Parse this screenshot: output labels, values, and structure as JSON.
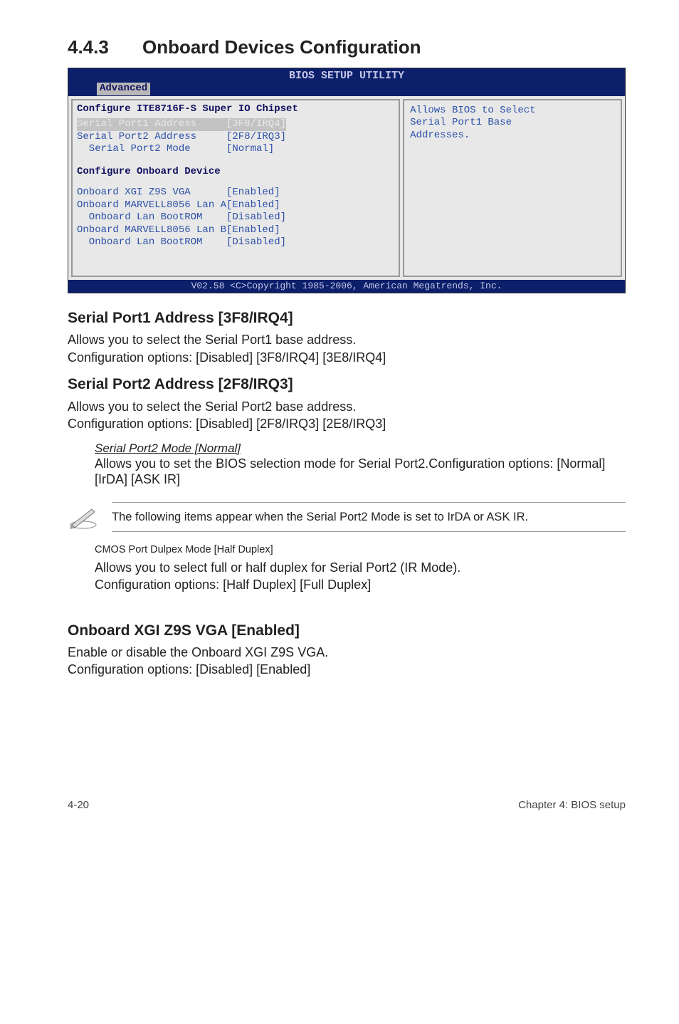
{
  "section": {
    "number": "4.4.3",
    "title": "Onboard Devices Configuration"
  },
  "bios": {
    "window_title": "BIOS SETUP UTILITY",
    "tab": "Advanced",
    "left": {
      "hdr1": "Configure ITE8716F-S Super IO Chipset",
      "rows1": [
        {
          "label": "Serial Port1 Address",
          "val": "[3F8/IRQ4]",
          "sel": true
        },
        {
          "label": "Serial Port2 Address",
          "val": "[2F8/IRQ3]"
        },
        {
          "label": "  Serial Port2 Mode",
          "val": "[Normal]"
        }
      ],
      "hdr2": "Configure Onboard Device",
      "rows2": [
        {
          "label": "Onboard XGI Z9S VGA",
          "val": "[Enabled]"
        },
        {
          "label": "Onboard MARVELL8056 Lan A",
          "val": "[Enabled]"
        },
        {
          "label": "  Onboard Lan BootROM",
          "val": "[Disabled]",
          "indent": true
        },
        {
          "label": "Onboard MARVELL8056 Lan B",
          "val": "[Enabled]"
        },
        {
          "label": "  Onboard Lan BootROM",
          "val": "[Disabled]",
          "indent": true
        }
      ]
    },
    "right_text": "Allows BIOS to Select\nSerial Port1 Base\nAddresses.",
    "footer": "V02.58 <C>Copyright 1985-2006, American Megatrends, Inc."
  },
  "sp1": {
    "head": "Serial Port1 Address [3F8/IRQ4]",
    "p1": "Allows you to select the Serial Port1 base address.",
    "p2": "Configuration options: [Disabled] [3F8/IRQ4] [3E8/IRQ4]"
  },
  "sp2": {
    "head": "Serial Port2 Address [2F8/IRQ3]",
    "p1": "Allows you to select the Serial Port2 base address.",
    "p2": "Configuration options: [Disabled] [2F8/IRQ3] [2E8/IRQ3]"
  },
  "sp2mode": {
    "it": "Serial Port2 Mode [Normal]",
    "p1": "Allows you to set the BIOS selection mode for Serial Port2.Configuration options: [Normal] [IrDA] [ASK IR]"
  },
  "note": "The following items appear when the Serial Port2 Mode is set to IrDA or ASK IR.",
  "cmos": {
    "head": "CMOS Port Dulpex Mode [Half Duplex]",
    "p1": "Allows you to select full or half duplex for Serial Port2 (IR Mode).",
    "p2": "Configuration options: [Half Duplex] [Full Duplex]"
  },
  "xgi": {
    "head": "Onboard XGI Z9S VGA [Enabled]",
    "p1": "Enable or disable the Onboard XGI Z9S VGA.",
    "p2": "Configuration options: [Disabled] [Enabled]"
  },
  "footer": {
    "left": "4-20",
    "right": "Chapter 4: BIOS setup"
  }
}
